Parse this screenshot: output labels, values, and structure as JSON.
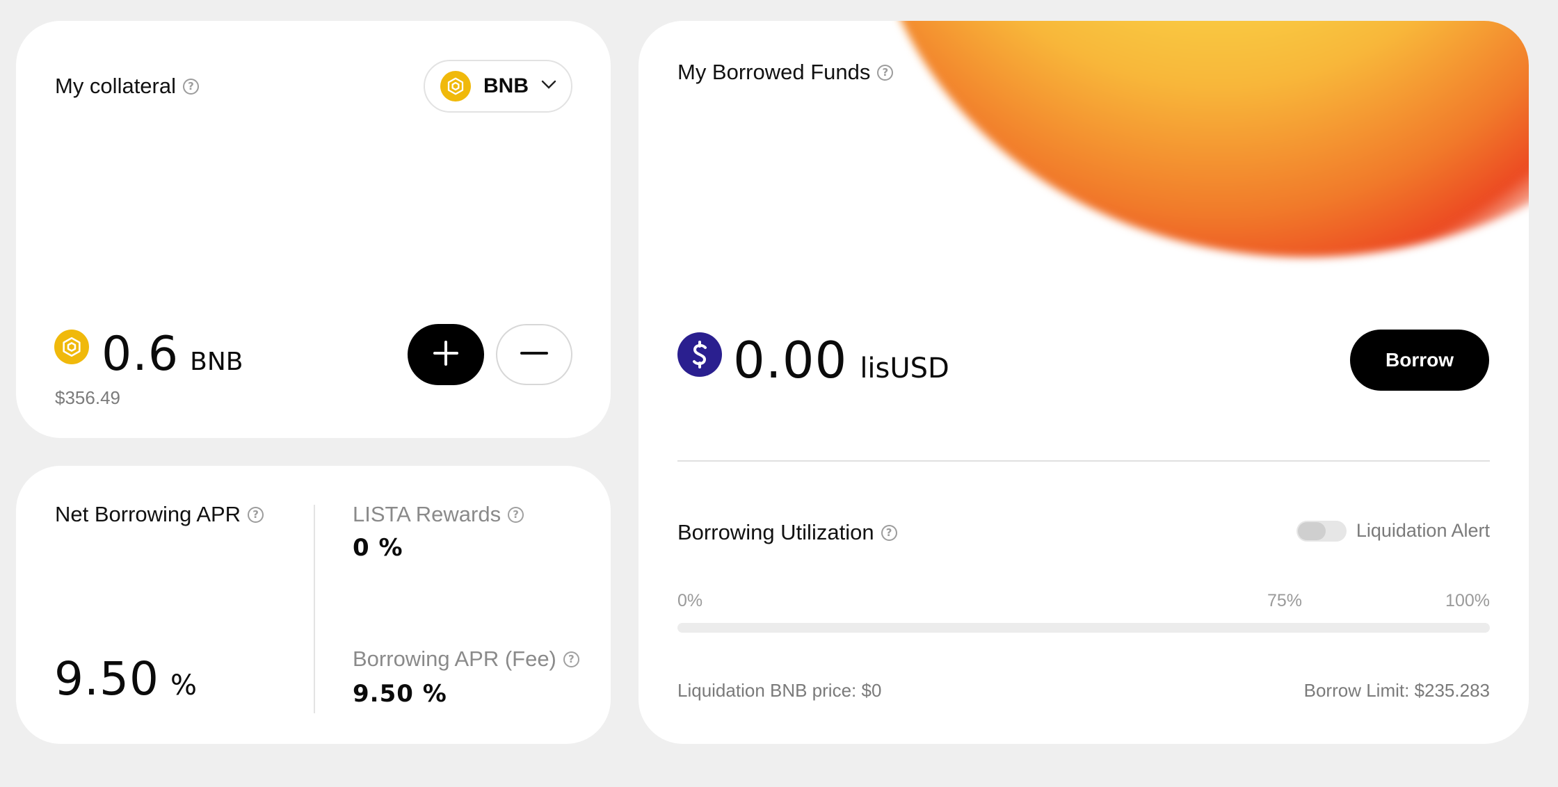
{
  "collateral": {
    "title": "My collateral",
    "help_icon": "question-circle-icon",
    "selected_asset": "BNB",
    "amount": "0.6",
    "unit": "BNB",
    "usd_value": "$356.49",
    "add_icon": "plus-icon",
    "remove_icon": "minus-icon"
  },
  "apr": {
    "net_title": "Net Borrowing APR",
    "net_value": "9.50",
    "net_unit": "%",
    "lista_title": "LISTA Rewards",
    "lista_value": "0 %",
    "fee_title": "Borrowing APR (Fee)",
    "fee_value": "9.50 %"
  },
  "borrowed": {
    "title": "My Borrowed Funds",
    "amount": "0.00",
    "unit": "lisUSD",
    "borrow_label": "Borrow",
    "utilization_title": "Borrowing Utilization",
    "alert_label": "Liquidation Alert",
    "alert_enabled": false,
    "ticks": [
      "0%",
      "75%",
      "100%"
    ],
    "utilization_fraction": 0,
    "liquidation_price": "Liquidation BNB price: $0",
    "borrow_limit": "Borrow Limit: $235.283"
  },
  "colors": {
    "accent": "#000000",
    "bnb": "#f0b90b",
    "lisusd": "#2a1f8f"
  }
}
